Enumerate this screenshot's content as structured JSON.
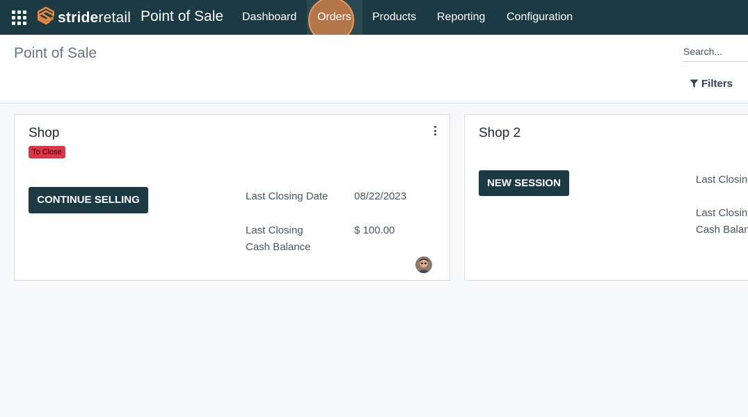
{
  "navbar": {
    "apps_icon": "apps-grid-icon",
    "logo": {
      "icon": "striderretail-logo-icon",
      "text_bold": "stride",
      "text_light": "retail",
      "accent_color": "#e98a3f"
    },
    "app_title": "Point of Sale",
    "menu": [
      {
        "label": "Dashboard"
      },
      {
        "label": "Orders"
      },
      {
        "label": "Products"
      },
      {
        "label": "Reporting"
      },
      {
        "label": "Configuration"
      }
    ],
    "background_color": "#1b3a44"
  },
  "control_panel": {
    "breadcrumb": "Point of Sale",
    "search": {
      "placeholder": "Search..."
    },
    "filters": {
      "label": "Filters",
      "icon": "filter-icon"
    }
  },
  "cards": [
    {
      "title": "Shop",
      "badge": "To Close",
      "badge_color": "#dc3545",
      "button": "CONTINUE SELLING",
      "info": [
        {
          "label": "Last Closing Date",
          "value": "08/22/2023"
        },
        {
          "label": "Last Closing Cash Balance",
          "value": "$ 100.00"
        }
      ],
      "menu_icon": "kebab-menu-icon",
      "avatar": "user-avatar"
    },
    {
      "title": "Shop 2",
      "button": "NEW SESSION",
      "info": [
        {
          "label": "Last Closing Date"
        },
        {
          "label": "Last Closing Cash Balance"
        }
      ]
    }
  ]
}
